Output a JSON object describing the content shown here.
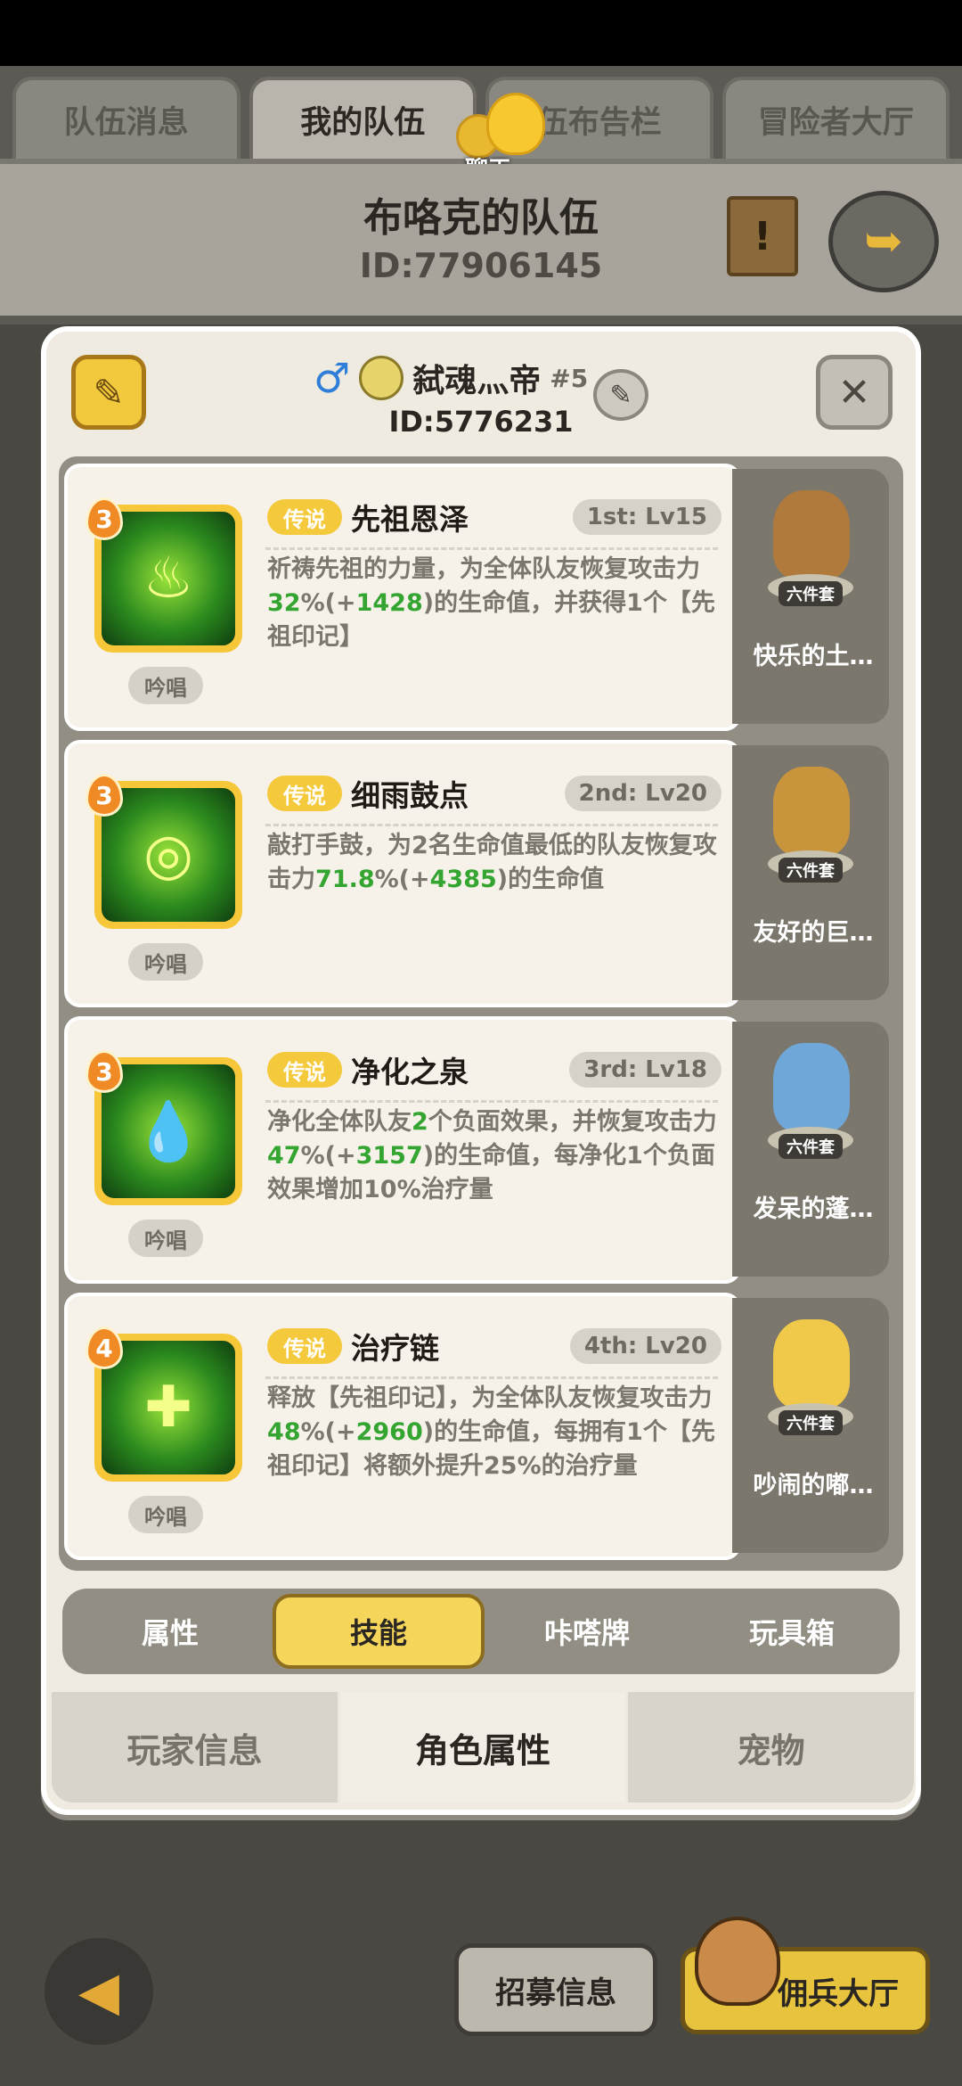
{
  "top_tabs": [
    "队伍消息",
    "我的队伍",
    "伍布告栏",
    "冒险者大厅"
  ],
  "chat": {
    "label": "聊天"
  },
  "team": {
    "name": "布咯克的队伍",
    "id": "ID:77906145"
  },
  "player": {
    "name": "弑魂灬帝",
    "rank": "#5",
    "id": "ID:5776231"
  },
  "skills": [
    {
      "badge": "3",
      "rarity": "传说",
      "name": "先祖恩泽",
      "level": "1st: Lv15",
      "desc_a": "祈祷先祖的力量，为全体队友恢复攻击力",
      "val1": "32",
      "mid1": "%(+",
      "val2": "1428",
      "desc_b": ")的生命值，并获得1个【先祖印记】",
      "chant": "吟唱",
      "icon": "ancestor-icon",
      "pet_name": "快乐的土…",
      "pet_tag": "六件套"
    },
    {
      "badge": "3",
      "rarity": "传说",
      "name": "细雨鼓点",
      "level": "2nd: Lv20",
      "desc_a": "敲打手鼓，为2名生命值最低的队友恢复攻击力",
      "val1": "71.8",
      "mid1": "%(+",
      "val2": "4385",
      "desc_b": ")的生命值",
      "chant": "吟唱",
      "icon": "rain-drum-icon",
      "pet_name": "友好的巨…",
      "pet_tag": "六件套"
    },
    {
      "badge": "3",
      "rarity": "传说",
      "name": "净化之泉",
      "level": "3rd: Lv18",
      "desc_a0": "净化全体队友",
      "val0": "2",
      "desc_a": "个负面效果，并恢复攻击力",
      "val1": "47",
      "mid1": "%(+",
      "val2": "3157",
      "desc_b": ")的生命值，每净化1个负面效果增加10%治疗量",
      "chant": "吟唱",
      "icon": "spring-icon",
      "pet_name": "发呆的蓬…",
      "pet_tag": "六件套"
    },
    {
      "badge": "4",
      "rarity": "传说",
      "name": "治疗链",
      "level": "4th: Lv20",
      "desc_a": "释放【先祖印记】，为全体队友恢复攻击力",
      "val1": "48",
      "mid1": "%(+",
      "val2": "2960",
      "desc_b": ")的生命值，每拥有1个【先祖印记】将额外提升25%的治疗量",
      "chant": "吟唱",
      "icon": "heal-chain-icon",
      "pet_name": "吵闹的嘟…",
      "pet_tag": "六件套"
    }
  ],
  "sub_tabs": [
    "属性",
    "技能",
    "咔嗒牌",
    "玩具箱"
  ],
  "bottom_tabs": [
    "玩家信息",
    "角色属性",
    "宠物"
  ],
  "buttons": {
    "recruit": "招募信息",
    "mercenary": "佣兵大厅"
  },
  "colors": {
    "accent_yellow": "#f5c93c",
    "value_green": "#33a530",
    "panel": "#f0ebe0"
  }
}
